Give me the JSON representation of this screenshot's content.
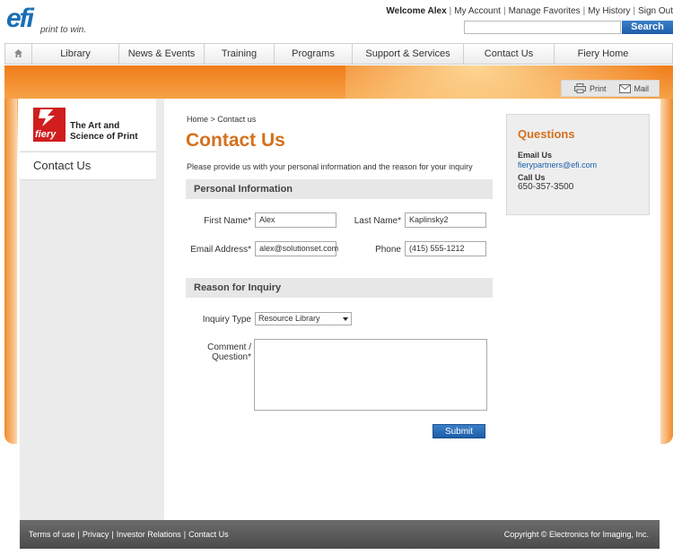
{
  "brand": {
    "logo": "efi",
    "tagline": "print to win.",
    "accent": "#d4701c",
    "nav_blue": "#1e5ea8"
  },
  "userbar": {
    "welcome": "Welcome Alex",
    "links": [
      "My Account",
      "Manage Favorites",
      "My History",
      "Sign Out"
    ]
  },
  "search": {
    "placeholder": "",
    "button_label": "Search"
  },
  "nav": {
    "home_icon": "home-icon",
    "items": [
      "Library",
      "News & Events",
      "Training",
      "Programs",
      "Support & Services",
      "Contact Us",
      "Fiery Home"
    ]
  },
  "tools": {
    "print_label": "Print",
    "mail_label": "Mail"
  },
  "sidebar": {
    "logo_text": "fiery",
    "tagline_line1": "The Art and",
    "tagline_line2": "Science of Print",
    "active_item": "Contact Us"
  },
  "main": {
    "breadcrumb": "Home > Contact us",
    "title": "Contact Us",
    "intro": "Please provide us with your personal information and the reason for your inquiry",
    "personal": {
      "heading": "Personal Information",
      "first_name_label": "First Name*",
      "first_name_value": "Alex",
      "last_name_label": "Last Name*",
      "last_name_value": "Kaplinsky2",
      "email_label": "Email Address*",
      "email_value": "alex@solutionset.com",
      "phone_label": "Phone",
      "phone_value": "(415) 555-1212"
    },
    "inquiry": {
      "heading": "Reason for Inquiry",
      "type_label": "Inquiry Type",
      "type_value": "Resource Library",
      "comment_label_line1": "Comment /",
      "comment_label_line2": "Question*",
      "comment_value": ""
    },
    "submit_label": "Submit"
  },
  "questions": {
    "title": "Questions",
    "email_heading": "Email Us",
    "email": "fierypartners@efi.com",
    "call_heading": "Call Us",
    "phone": "650-357-3500"
  },
  "footer": {
    "links": [
      "Terms of use",
      "Privacy",
      "Investor Relations",
      "Contact Us"
    ],
    "copyright": "Copyright © Electronics for Imaging, Inc."
  }
}
